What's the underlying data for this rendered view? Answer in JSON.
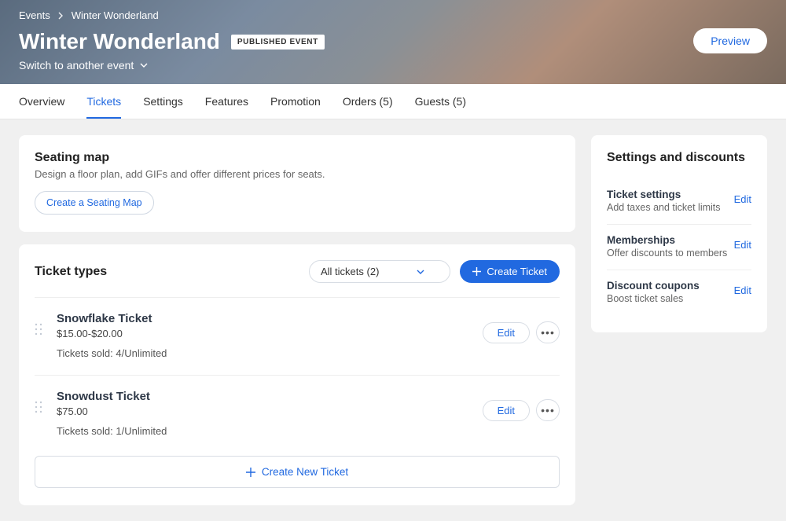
{
  "breadcrumb": {
    "root": "Events",
    "current": "Winter Wonderland"
  },
  "header": {
    "title": "Winter Wonderland",
    "badge": "PUBLISHED EVENT",
    "switch_label": "Switch to another event",
    "preview_label": "Preview"
  },
  "tabs": {
    "overview": "Overview",
    "tickets": "Tickets",
    "settings": "Settings",
    "features": "Features",
    "promotion": "Promotion",
    "orders": "Orders (5)",
    "guests": "Guests (5)"
  },
  "seating": {
    "title": "Seating map",
    "desc": "Design a floor plan, add GIFs and offer different prices for seats.",
    "button": "Create a Seating Map"
  },
  "ticket_types": {
    "title": "Ticket types",
    "filter_label": "All tickets (2)",
    "create_label": "Create Ticket",
    "tickets": [
      {
        "name": "Snowflake Ticket",
        "price": "$15.00-$20.00",
        "sold": "Tickets sold: 4/Unlimited"
      },
      {
        "name": "Snowdust Ticket",
        "price": "$75.00",
        "sold": "Tickets sold: 1/Unlimited"
      }
    ],
    "edit_label": "Edit",
    "create_new_label": "Create New Ticket"
  },
  "side": {
    "title": "Settings and discounts",
    "edit_label": "Edit",
    "items": [
      {
        "label": "Ticket settings",
        "desc": "Add taxes and ticket limits"
      },
      {
        "label": "Memberships",
        "desc": "Offer discounts to members"
      },
      {
        "label": "Discount coupons",
        "desc": "Boost ticket sales"
      }
    ]
  }
}
